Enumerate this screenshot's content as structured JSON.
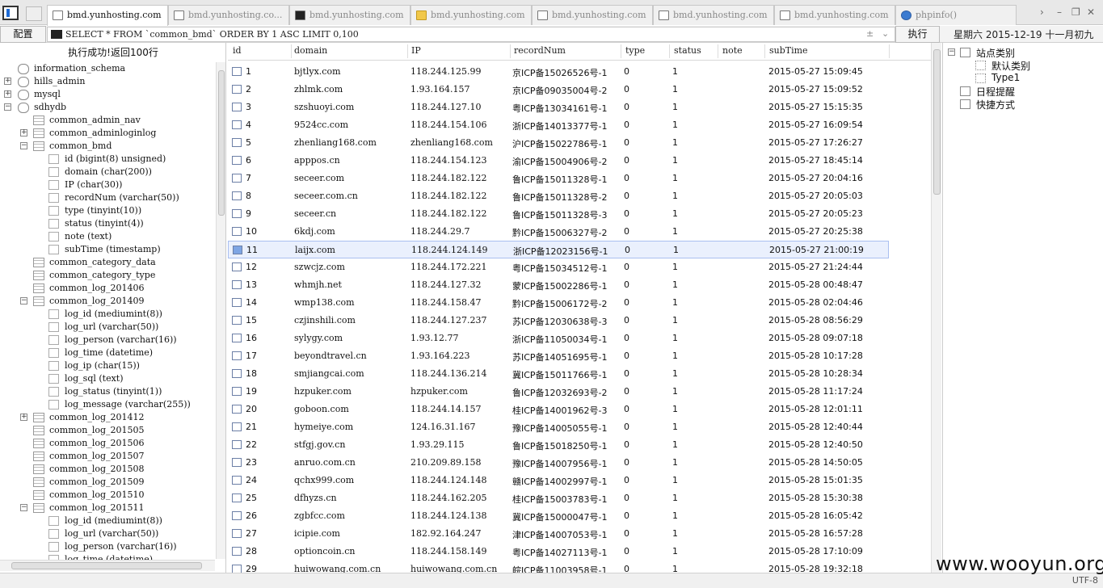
{
  "tabs": [
    {
      "label": "bmd.yunhosting.com",
      "icon": "page-icon",
      "active": true
    },
    {
      "label": "bmd.yunhosting.co...",
      "icon": "page-icon",
      "active": false
    },
    {
      "label": "bmd.yunhosting.com",
      "icon": "terminal-icon",
      "active": false
    },
    {
      "label": "bmd.yunhosting.com",
      "icon": "folder-icon",
      "active": false
    },
    {
      "label": "bmd.yunhosting.com",
      "icon": "page-icon",
      "active": false
    },
    {
      "label": "bmd.yunhosting.com",
      "icon": "page-icon",
      "active": false
    },
    {
      "label": "bmd.yunhosting.com",
      "icon": "page-icon",
      "active": false
    },
    {
      "label": "phpinfo()",
      "icon": "php-icon",
      "active": false
    }
  ],
  "query": {
    "config_label": "配置",
    "sql": "SELECT * FROM `common_bmd` ORDER BY 1 ASC LIMIT 0,100",
    "execute_label": "执行",
    "date": "星期六 2015-12-19 十一月初九"
  },
  "left": {
    "result_message": "执行成功!返回100行",
    "tree": [
      {
        "label": "information_schema",
        "level": 0,
        "type": "db",
        "expander": ""
      },
      {
        "label": "hills_admin",
        "level": 0,
        "type": "db",
        "expander": "+"
      },
      {
        "label": "mysql",
        "level": 0,
        "type": "db",
        "expander": "+"
      },
      {
        "label": "sdhydb",
        "level": 0,
        "type": "db",
        "expander": "−"
      },
      {
        "label": "common_admin_nav",
        "level": 1,
        "type": "table",
        "expander": ""
      },
      {
        "label": "common_adminloginlog",
        "level": 1,
        "type": "table",
        "expander": "+"
      },
      {
        "label": "common_bmd",
        "level": 1,
        "type": "table",
        "expander": "−"
      },
      {
        "label": "id (bigint(8) unsigned)",
        "level": 2,
        "type": "column",
        "expander": ""
      },
      {
        "label": "domain (char(200))",
        "level": 2,
        "type": "column",
        "expander": ""
      },
      {
        "label": "IP (char(30))",
        "level": 2,
        "type": "column",
        "expander": ""
      },
      {
        "label": "recordNum (varchar(50))",
        "level": 2,
        "type": "column",
        "expander": ""
      },
      {
        "label": "type (tinyint(10))",
        "level": 2,
        "type": "column",
        "expander": ""
      },
      {
        "label": "status (tinyint(4))",
        "level": 2,
        "type": "column",
        "expander": ""
      },
      {
        "label": "note (text)",
        "level": 2,
        "type": "column",
        "expander": ""
      },
      {
        "label": "subTime (timestamp)",
        "level": 2,
        "type": "column",
        "expander": ""
      },
      {
        "label": "common_category_data",
        "level": 1,
        "type": "table",
        "expander": ""
      },
      {
        "label": "common_category_type",
        "level": 1,
        "type": "table",
        "expander": ""
      },
      {
        "label": "common_log_201406",
        "level": 1,
        "type": "table",
        "expander": ""
      },
      {
        "label": "common_log_201409",
        "level": 1,
        "type": "table",
        "expander": "−"
      },
      {
        "label": "log_id (mediumint(8))",
        "level": 2,
        "type": "column",
        "expander": ""
      },
      {
        "label": "log_url (varchar(50))",
        "level": 2,
        "type": "column",
        "expander": ""
      },
      {
        "label": "log_person (varchar(16))",
        "level": 2,
        "type": "column",
        "expander": ""
      },
      {
        "label": "log_time (datetime)",
        "level": 2,
        "type": "column",
        "expander": ""
      },
      {
        "label": "log_ip (char(15))",
        "level": 2,
        "type": "column",
        "expander": ""
      },
      {
        "label": "log_sql (text)",
        "level": 2,
        "type": "column",
        "expander": ""
      },
      {
        "label": "log_status (tinyint(1))",
        "level": 2,
        "type": "column",
        "expander": ""
      },
      {
        "label": "log_message (varchar(255))",
        "level": 2,
        "type": "column",
        "expander": ""
      },
      {
        "label": "common_log_201412",
        "level": 1,
        "type": "table",
        "expander": "+"
      },
      {
        "label": "common_log_201505",
        "level": 1,
        "type": "table",
        "expander": ""
      },
      {
        "label": "common_log_201506",
        "level": 1,
        "type": "table",
        "expander": ""
      },
      {
        "label": "common_log_201507",
        "level": 1,
        "type": "table",
        "expander": ""
      },
      {
        "label": "common_log_201508",
        "level": 1,
        "type": "table",
        "expander": ""
      },
      {
        "label": "common_log_201509",
        "level": 1,
        "type": "table",
        "expander": ""
      },
      {
        "label": "common_log_201510",
        "level": 1,
        "type": "table",
        "expander": ""
      },
      {
        "label": "common_log_201511",
        "level": 1,
        "type": "table",
        "expander": "−"
      },
      {
        "label": "log_id (mediumint(8))",
        "level": 2,
        "type": "column",
        "expander": ""
      },
      {
        "label": "log_url (varchar(50))",
        "level": 2,
        "type": "column",
        "expander": ""
      },
      {
        "label": "log_person (varchar(16))",
        "level": 2,
        "type": "column",
        "expander": ""
      },
      {
        "label": "log_time (datetime)",
        "level": 2,
        "type": "column",
        "expander": ""
      }
    ]
  },
  "grid": {
    "columns": [
      "id",
      "domain",
      "IP",
      "recordNum",
      "type",
      "status",
      "note",
      "subTime"
    ],
    "selected_id": "11",
    "rows": [
      [
        "1",
        "bjtlyx.com",
        "118.244.125.99",
        "京ICP备15026526号-1",
        "0",
        "1",
        "",
        "2015-05-27 15:09:45"
      ],
      [
        "2",
        "zhlmk.com",
        "1.93.164.157",
        "京ICP备09035004号-2",
        "0",
        "1",
        "",
        "2015-05-27 15:09:52"
      ],
      [
        "3",
        "szshuoyi.com",
        "118.244.127.10",
        "粤ICP备13034161号-1",
        "0",
        "1",
        "",
        "2015-05-27 15:15:35"
      ],
      [
        "4",
        "9524cc.com",
        "118.244.154.106",
        "浙ICP备14013377号-1",
        "0",
        "1",
        "",
        "2015-05-27 16:09:54"
      ],
      [
        "5",
        "zhenliang168.com",
        "zhenliang168.com",
        "沪ICP备15022786号-1",
        "0",
        "1",
        "",
        "2015-05-27 17:26:27"
      ],
      [
        "6",
        "apppos.cn",
        "118.244.154.123",
        "渝ICP备15004906号-2",
        "0",
        "1",
        "",
        "2015-05-27 18:45:14"
      ],
      [
        "7",
        "seceer.com",
        "118.244.182.122",
        "鲁ICP备15011328号-1",
        "0",
        "1",
        "",
        "2015-05-27 20:04:16"
      ],
      [
        "8",
        "seceer.com.cn",
        "118.244.182.122",
        "鲁ICP备15011328号-2",
        "0",
        "1",
        "",
        "2015-05-27 20:05:03"
      ],
      [
        "9",
        "seceer.cn",
        "118.244.182.122",
        "鲁ICP备15011328号-3",
        "0",
        "1",
        "",
        "2015-05-27 20:05:23"
      ],
      [
        "10",
        "6kdj.com",
        "118.244.29.7",
        "黔ICP备15006327号-2",
        "0",
        "1",
        "",
        "2015-05-27 20:25:38"
      ],
      [
        "11",
        "laijx.com",
        "118.244.124.149",
        "浙ICP备12023156号-1",
        "0",
        "1",
        "",
        "2015-05-27 21:00:19"
      ],
      [
        "12",
        "szwcjz.com",
        "118.244.172.221",
        "粤ICP备15034512号-1",
        "0",
        "1",
        "",
        "2015-05-27 21:24:44"
      ],
      [
        "13",
        "whmjh.net",
        "118.244.127.32",
        "蒙ICP备15002286号-1",
        "0",
        "1",
        "",
        "2015-05-28 00:48:47"
      ],
      [
        "14",
        "wmp138.com",
        "118.244.158.47",
        "黔ICP备15006172号-2",
        "0",
        "1",
        "",
        "2015-05-28 02:04:46"
      ],
      [
        "15",
        "czjinshili.com",
        "118.244.127.237",
        "苏ICP备12030638号-3",
        "0",
        "1",
        "",
        "2015-05-28 08:56:29"
      ],
      [
        "16",
        "sylygy.com",
        "1.93.12.77",
        "浙ICP备11050034号-1",
        "0",
        "1",
        "",
        "2015-05-28 09:07:18"
      ],
      [
        "17",
        "beyondtravel.cn",
        "1.93.164.223",
        "苏ICP备14051695号-1",
        "0",
        "1",
        "",
        "2015-05-28 10:17:28"
      ],
      [
        "18",
        "smjiangcai.com",
        "118.244.136.214",
        "冀ICP备15011766号-1",
        "0",
        "1",
        "",
        "2015-05-28 10:28:34"
      ],
      [
        "19",
        "hzpuker.com",
        "hzpuker.com",
        "鲁ICP备12032693号-2",
        "0",
        "1",
        "",
        "2015-05-28 11:17:24"
      ],
      [
        "20",
        "goboon.com",
        "118.244.14.157",
        "桂ICP备14001962号-3",
        "0",
        "1",
        "",
        "2015-05-28 12:01:11"
      ],
      [
        "21",
        "hymeiye.com",
        "124.16.31.167",
        "豫ICP备14005055号-1",
        "0",
        "1",
        "",
        "2015-05-28 12:40:44"
      ],
      [
        "22",
        "stfgj.gov.cn",
        "1.93.29.115",
        "鲁ICP备15018250号-1",
        "0",
        "1",
        "",
        "2015-05-28 12:40:50"
      ],
      [
        "23",
        "anruo.com.cn",
        "210.209.89.158",
        "豫ICP备14007956号-1",
        "0",
        "1",
        "",
        "2015-05-28 14:50:05"
      ],
      [
        "24",
        "qchx999.com",
        "118.244.124.148",
        "赣ICP备14002997号-1",
        "0",
        "1",
        "",
        "2015-05-28 15:01:35"
      ],
      [
        "25",
        "dfhyzs.cn",
        "118.244.162.205",
        "桂ICP备15003783号-1",
        "0",
        "1",
        "",
        "2015-05-28 15:30:38"
      ],
      [
        "26",
        "zgbfcc.com",
        "118.244.124.138",
        "冀ICP备15000047号-1",
        "0",
        "1",
        "",
        "2015-05-28 16:05:42"
      ],
      [
        "27",
        "icipie.com",
        "182.92.164.247",
        "津ICP备14007053号-1",
        "0",
        "1",
        "",
        "2015-05-28 16:57:28"
      ],
      [
        "28",
        "optioncoin.cn",
        "118.244.158.149",
        "粤ICP备14027113号-1",
        "0",
        "1",
        "",
        "2015-05-28 17:10:09"
      ],
      [
        "29",
        "huiwowang.com.cn",
        "huiwowang.com.cn",
        "皖ICP备11003958号-1",
        "0",
        "1",
        "",
        "2015-05-28 19:32:18"
      ]
    ]
  },
  "right": {
    "items": [
      {
        "label": "站点类别",
        "level": 0,
        "expander": "−"
      },
      {
        "label": "默认类别",
        "level": 1,
        "expander": ""
      },
      {
        "label": "Type1",
        "level": 1,
        "expander": ""
      },
      {
        "label": "日程提醒",
        "level": 0,
        "expander": ""
      },
      {
        "label": "快捷方式",
        "level": 0,
        "expander": ""
      }
    ]
  },
  "status": {
    "encoding": "UTF-8"
  },
  "watermark": "www.wooyun.org"
}
